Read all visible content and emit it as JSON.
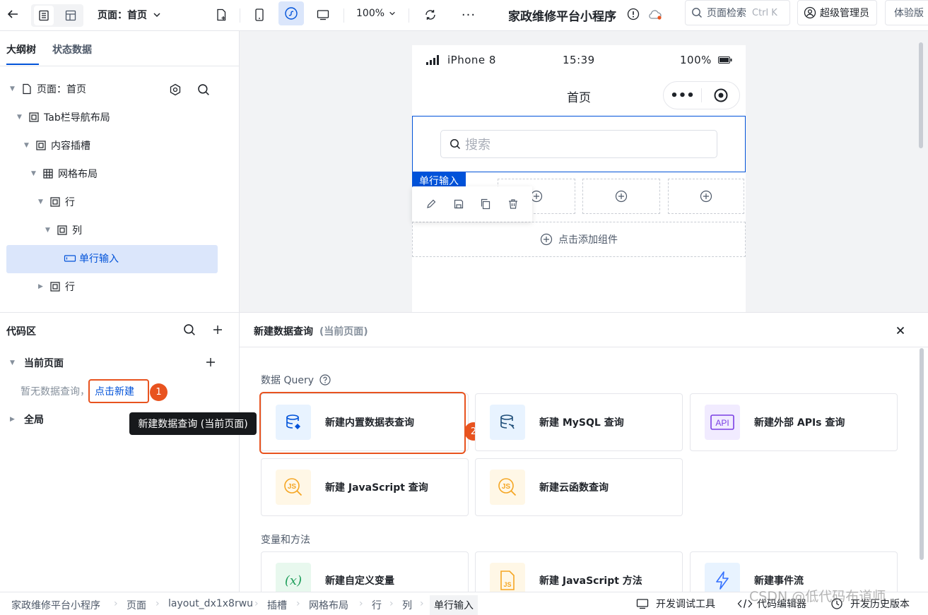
{
  "topbar": {
    "page_label": "页面：首页",
    "zoom": "100%",
    "app_title": "家政维修平台小程序",
    "search_label": "页面检索",
    "search_shortcut": "Ctrl K",
    "user_label": "超级管理员",
    "version_label": "体验版"
  },
  "outline": {
    "tabs": [
      "大纲树",
      "状态数据"
    ],
    "items": [
      {
        "label": "页面：首页"
      },
      {
        "label": "Tab栏导航布局"
      },
      {
        "label": "内容插槽"
      },
      {
        "label": "网格布局"
      },
      {
        "label": "行"
      },
      {
        "label": "列"
      },
      {
        "label": "单行输入"
      },
      {
        "label": "行"
      }
    ]
  },
  "code": {
    "title": "代码区",
    "current_page": "当前页面",
    "empty_text": "暂无数据查询，",
    "new_link": "点击新建",
    "global": "全局",
    "tooltip": "新建数据查询 (当前页面)",
    "marker1": "1",
    "marker2": "2"
  },
  "phone": {
    "carrier": "iPhone 8",
    "time": "15:39",
    "battery": "100%",
    "nav_title": "首页",
    "search_placeholder": "搜索",
    "selected_tag": "单行输入",
    "add_component": "点击添加组件"
  },
  "query_panel": {
    "title": "新建数据查询",
    "title_sub": "(当前页面)",
    "section_query": "数据 Query",
    "cards_query": [
      {
        "label": "新建内置数据表查询",
        "icon": "database-icon"
      },
      {
        "label": "新建 MySQL 查询",
        "icon": "mysql-icon"
      },
      {
        "label": "新建外部 APIs 查询",
        "icon": "api-icon"
      },
      {
        "label": "新建 JavaScript 查询",
        "icon": "js-query-icon"
      },
      {
        "label": "新建云函数查询",
        "icon": "cloud-function-icon"
      }
    ],
    "section_vars": "变量和方法",
    "cards_vars": [
      {
        "label": "新建自定义变量",
        "icon": "variable-icon"
      },
      {
        "label": "新建 JavaScript 方法",
        "icon": "js-method-icon"
      },
      {
        "label": "新建事件流",
        "icon": "flash-icon"
      }
    ]
  },
  "statusbar": {
    "crumbs": [
      "家政维修平台小程序",
      "页面",
      "layout_dx1x8rwu",
      "插槽",
      "网格布局",
      "行",
      "列",
      "单行输入"
    ],
    "debug": "开发调试工具",
    "code_editor": "代码编辑器",
    "history": "开发历史版本"
  },
  "watermark": "CSDN @低代码布道师",
  "colors": {
    "primary": "#0052d9",
    "highlight": "#dbe6fb",
    "annotation": "#e8531f"
  }
}
